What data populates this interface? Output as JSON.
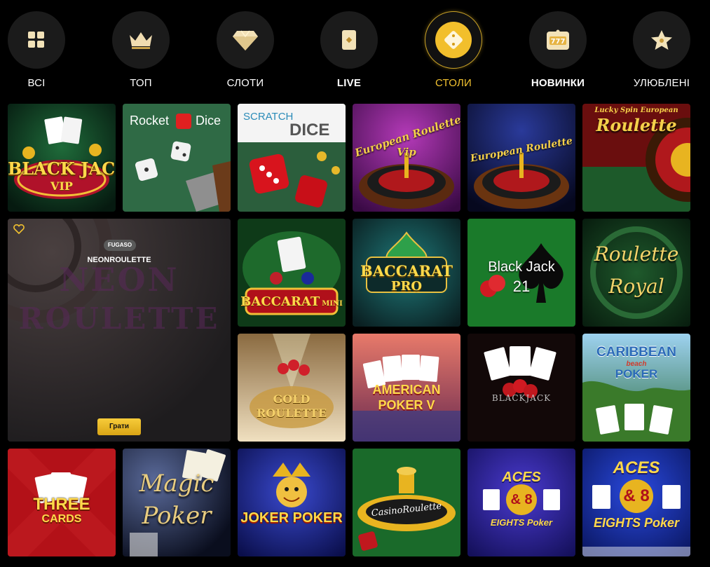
{
  "categories": [
    {
      "label": "ВСІ",
      "icon": "grid-icon",
      "active": false
    },
    {
      "label": "ТОП",
      "icon": "crown-icon",
      "active": false
    },
    {
      "label": "СЛОТИ",
      "icon": "diamond-icon",
      "active": false
    },
    {
      "label": "LIVE",
      "icon": "card-icon",
      "active": false
    },
    {
      "label": "СТОЛИ",
      "icon": "dice-icon",
      "active": true
    },
    {
      "label": "НОВИНКИ",
      "icon": "slot-777-icon",
      "active": false
    },
    {
      "label": "УЛЮБЛЕНІ",
      "icon": "star-icon",
      "active": false
    }
  ],
  "colors": {
    "accent": "#f2c230",
    "background": "#000000",
    "tile_dark": "#1b1b1b"
  },
  "featured": {
    "provider": "FUGASO",
    "name": "NEONROULETTE",
    "play_label": "Грати",
    "favorite_icon": "heart-icon",
    "art_line1": "NEON",
    "art_line2": "ROULETTE"
  },
  "games": [
    {
      "id": "blackjack-vip",
      "t1": "BLACK JACK",
      "t2": "VIP"
    },
    {
      "id": "rocket-dice",
      "t1": "Rocket",
      "t2": "Dice"
    },
    {
      "id": "scratch-dice",
      "t1": "SCRATCH",
      "t2": "DICE"
    },
    {
      "id": "european-roulette-vip",
      "t1": "European Roulette",
      "t2": "Vip"
    },
    {
      "id": "european-roulette",
      "t1": "European Roulette",
      "t2": ""
    },
    {
      "id": "lucky-spin-roulette",
      "t1": "Lucky Spin European",
      "t2": "Roulette"
    },
    {
      "id": "baccarat-mini",
      "t1": "BACCARAT",
      "t2": "MINI"
    },
    {
      "id": "baccarat-pro",
      "t1": "BACCARAT",
      "t2": "PRO"
    },
    {
      "id": "black-jack-21",
      "t1": "Black Jack",
      "t2": "21"
    },
    {
      "id": "roulette-royal",
      "t1": "Roulette",
      "t2": "Royal"
    },
    {
      "id": "gold-roulette",
      "t1": "GOLD",
      "t2": "ROULETTE"
    },
    {
      "id": "american-poker-v",
      "t1": "AMERICAN",
      "t2": "POKER V"
    },
    {
      "id": "blackjack-cards",
      "t1": "BLACKJACK",
      "t2": ""
    },
    {
      "id": "caribbean-beach-poker",
      "t1": "CARIBBEAN",
      "t2": "beach",
      "t3": "POKER"
    },
    {
      "id": "three-cards",
      "t1": "THREE",
      "t2": "CARDS"
    },
    {
      "id": "magic-poker",
      "t1": "Magic",
      "t2": "Poker"
    },
    {
      "id": "joker-poker",
      "t1": "JOKER",
      "t2": "POKER"
    },
    {
      "id": "casino-roulette",
      "t1": "CasinoRoulette",
      "t2": ""
    },
    {
      "id": "aces-eights-1",
      "t1": "ACES",
      "t2": "& 8",
      "t3": "EIGHTS Poker"
    },
    {
      "id": "aces-eights-2",
      "t1": "ACES",
      "t2": "& 8",
      "t3": "EIGHTS Poker"
    }
  ]
}
